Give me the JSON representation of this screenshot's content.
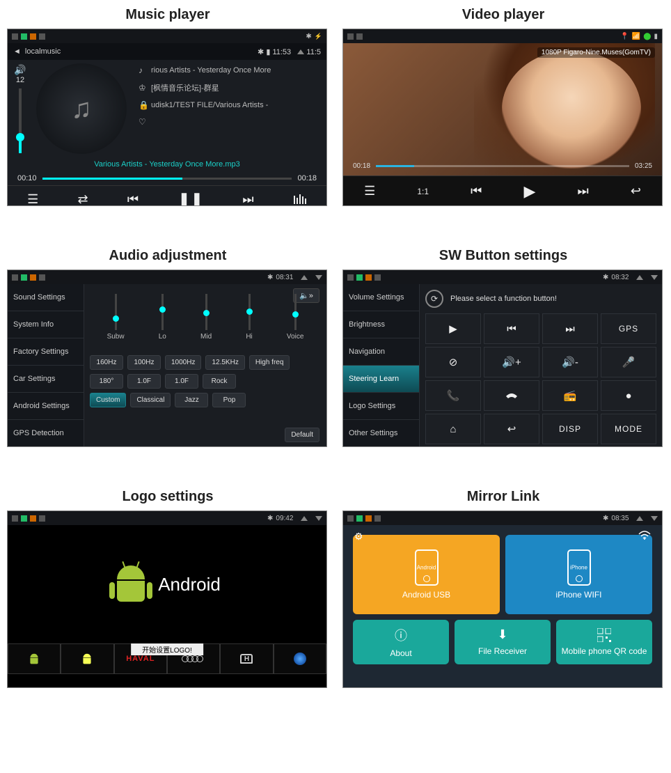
{
  "cards": {
    "music": {
      "title": "Music player"
    },
    "video": {
      "title": "Video player"
    },
    "audio": {
      "title": "Audio adjustment"
    },
    "sw": {
      "title": "SW Button settings"
    },
    "logo": {
      "title": "Logo settings"
    },
    "mirror": {
      "title": "Mirror Link"
    }
  },
  "music": {
    "topbar": {
      "source": "localmusic",
      "time": "11:53",
      "alt_time": "11:5"
    },
    "volume": {
      "level": "12",
      "percent": 18
    },
    "meta": {
      "track": "rious Artists - Yesterday Once More",
      "artist": "[枫情音乐论坛]-群星",
      "path": "udisk1/TEST FILE/Various Artists -"
    },
    "now_playing": "Various Artists - Yesterday Once More.mp3",
    "progress": {
      "current": "00:10",
      "total": "00:18",
      "percent": 56
    }
  },
  "video": {
    "badge": "1080P Figaro-Nine.Muses(GomTV)",
    "progress": {
      "current": "00:18",
      "total": "03:25",
      "percent": 9
    },
    "ratio": "1:1"
  },
  "audio": {
    "status_time": "08:31",
    "sidebar": [
      "Sound Settings",
      "System Info",
      "Factory Settings",
      "Car Settings",
      "Android Settings",
      "GPS Detection"
    ],
    "eq_labels": [
      "Subw",
      "Lo",
      "Mid",
      "Hi",
      "Voice"
    ],
    "eq_positions": [
      60,
      35,
      44,
      40,
      48
    ],
    "row1": [
      "160Hz",
      "100Hz",
      "1000Hz",
      "12.5KHz",
      "High freq"
    ],
    "row2": [
      "180°",
      "1.0F",
      "1.0F",
      "Rock"
    ],
    "row3": [
      "Custom",
      "Classical",
      "Jazz",
      "Pop"
    ],
    "default_btn": "Default"
  },
  "sw": {
    "status_time": "08:32",
    "sidebar": [
      "Volume Settings",
      "Brightness",
      "Navigation",
      "Steering Learn",
      "Logo Settings",
      "Other Settings"
    ],
    "active_sidebar": 3,
    "prompt": "Please select a function button!",
    "cells": [
      {
        "icon": "▶"
      },
      {
        "icon": "⏮"
      },
      {
        "icon": "⏭"
      },
      {
        "text": "GPS"
      },
      {
        "icon": "⊘"
      },
      {
        "icon": "vol+"
      },
      {
        "icon": "vol-"
      },
      {
        "icon": "🎤"
      },
      {
        "icon": "📞"
      },
      {
        "icon": "end"
      },
      {
        "icon": "📻"
      },
      {
        "icon": "●"
      },
      {
        "icon": "⌂"
      },
      {
        "icon": "↩"
      },
      {
        "text": "DISP"
      },
      {
        "text": "MODE"
      }
    ]
  },
  "logo": {
    "status_time": "09:42",
    "main_text": "Android",
    "loading": "开始设置LOGO!"
  },
  "mirror": {
    "status_time": "08:35",
    "tiles": {
      "android": {
        "label": "Android USB",
        "badge": "Android"
      },
      "iphone": {
        "label": "iPhone WIFI",
        "badge": "iPhone"
      },
      "about": "About",
      "file": "File Receiver",
      "qr": "Mobile phone QR code"
    }
  }
}
